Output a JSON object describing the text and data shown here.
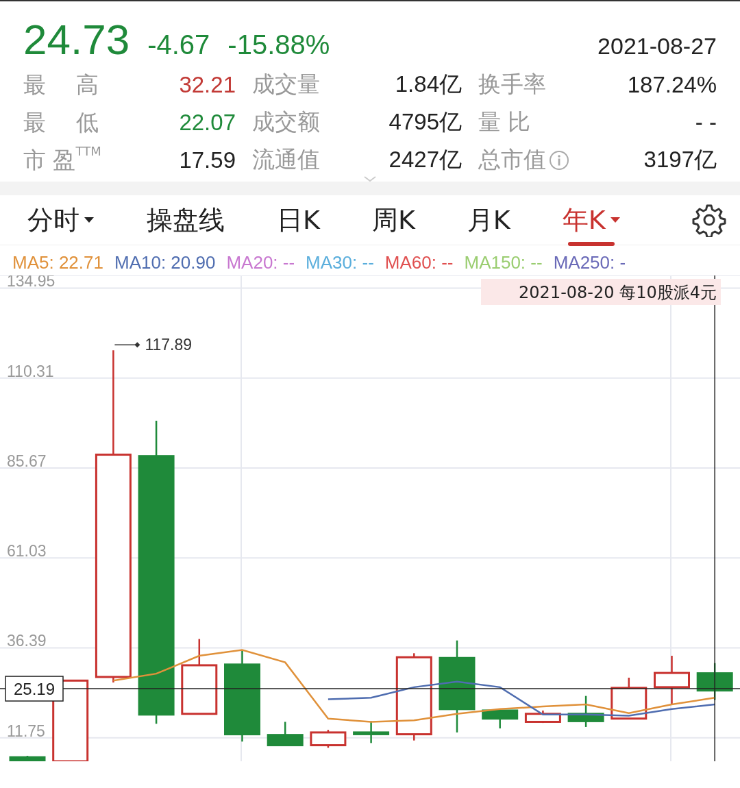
{
  "quote": {
    "price": "24.73",
    "change": "-4.67",
    "change_pct": "-15.88%",
    "date": "2021-08-27",
    "color": "#1f8a3a"
  },
  "stats": [
    {
      "label": "最 高",
      "value": "32.21",
      "color": "#c23a36",
      "label2": "成交量",
      "value2": "1.84亿",
      "label3": "换手率",
      "value3": "187.24%"
    },
    {
      "label": "最 低",
      "value": "22.07",
      "color": "#1f8a3a",
      "label2": "成交额",
      "value2": "4795亿",
      "label3": "量 比",
      "value3": "- -"
    },
    {
      "label": "市 盈$^{TTM}$",
      "value": "17.59",
      "color": "#222222",
      "label2": "流通值",
      "value2": "2427亿",
      "label3": "总市值",
      "value3": "3197亿",
      "info": true
    }
  ],
  "tabs": [
    {
      "label": "分时",
      "selected": false,
      "dropdown": true
    },
    {
      "label": "操盘线",
      "selected": false,
      "dropdown": false
    },
    {
      "label": "日K",
      "selected": false,
      "dropdown": false
    },
    {
      "label": "周K",
      "selected": false,
      "dropdown": false
    },
    {
      "label": "月K",
      "selected": false,
      "dropdown": false
    },
    {
      "label": "年K",
      "selected": true,
      "dropdown": true
    }
  ],
  "ma_legend": [
    {
      "label": "MA5: 22.71",
      "color": "#e0913a"
    },
    {
      "label": "MA10: 20.90",
      "color": "#4f6db0"
    },
    {
      "label": "MA20: --",
      "color": "#c878d0"
    },
    {
      "label": "MA30: --",
      "color": "#5aaedc"
    },
    {
      "label": "MA60: --",
      "color": "#e05050"
    },
    {
      "label": "MA150: --",
      "color": "#9acd70"
    },
    {
      "label": "MA250: -",
      "color": "#6a6ab8"
    }
  ],
  "price_axis": [
    "134.95",
    "110.31",
    "85.67",
    "61.03",
    "36.39",
    "11.75"
  ],
  "max_label": "117.89",
  "crosshair": {
    "value": "25.19",
    "tooltip": "2021-08-20 每10股派4元"
  }
}
